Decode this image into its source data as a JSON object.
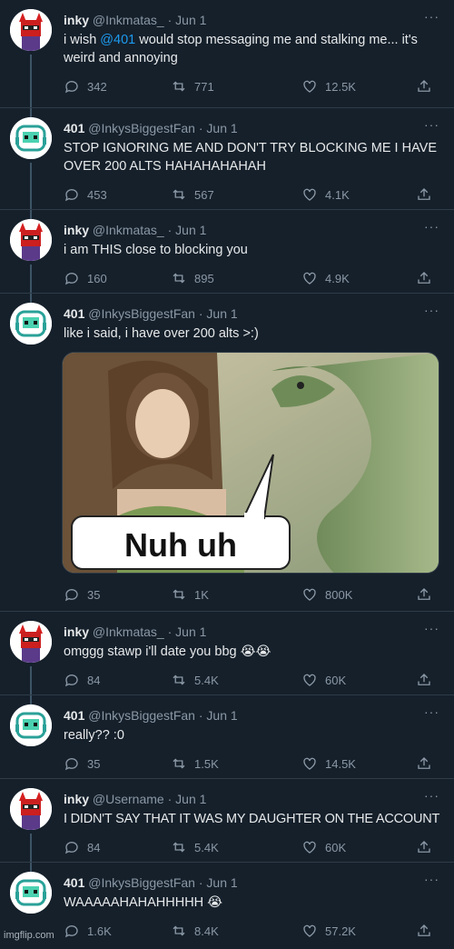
{
  "tweets": [
    {
      "name": "inky",
      "handle": "@Inkmatas_",
      "date": "Jun 1",
      "text_before": "i wish ",
      "mention": "@401",
      "text_after": " would stop messaging me and stalking me... it's weird and annoying",
      "replies": "342",
      "retweets": "771",
      "likes": "12.5K",
      "avatar": "red-devil-avatar"
    },
    {
      "name": "401",
      "handle": "@InkysBiggestFan",
      "date": "Jun 1",
      "text": "STOP IGNORING ME AND DON'T TRY BLOCKING ME I HAVE OVER 200 ALTS HAHAHAHAHAH",
      "replies": "453",
      "retweets": "567",
      "likes": "4.1K",
      "avatar": "green-robot-avatar"
    },
    {
      "name": "inky",
      "handle": "@Inkmatas_",
      "date": "Jun 1",
      "text": "i am THIS close to blocking you",
      "replies": "160",
      "retweets": "895",
      "likes": "4.9K",
      "avatar": "red-devil-avatar"
    },
    {
      "name": "401",
      "handle": "@InkysBiggestFan",
      "date": "Jun 1",
      "text": "like i said, i have over 200 alts >:)",
      "media_caption": "Nuh uh",
      "replies": "35",
      "retweets": "1K",
      "likes": "800K",
      "avatar": "green-robot-avatar"
    },
    {
      "name": "inky",
      "handle": "@Inkmatas_",
      "date": "Jun 1",
      "text": "omggg stawp i'll date you bbg 😭😭",
      "replies": "84",
      "retweets": "5.4K",
      "likes": "60K",
      "avatar": "red-devil-avatar"
    },
    {
      "name": "401",
      "handle": "@InkysBiggestFan",
      "date": "Jun 1",
      "text": "really?? :0",
      "replies": "35",
      "retweets": "1.5K",
      "likes": "14.5K",
      "avatar": "green-robot-avatar"
    },
    {
      "name": "inky",
      "handle": "@Username",
      "date": "Jun 1",
      "text": "I DIDN'T SAY THAT IT WAS MY DAUGHTER ON THE ACCOUNT",
      "replies": "84",
      "retweets": "5.4K",
      "likes": "60K",
      "avatar": "red-devil-avatar"
    },
    {
      "name": "401",
      "handle": "@InkysBiggestFan",
      "date": "Jun 1",
      "text": "WAAAAAHAHAHHHHH 😭",
      "replies": "1.6K",
      "retweets": "8.4K",
      "likes": "57.2K",
      "avatar": "green-robot-avatar"
    }
  ],
  "dot": "·",
  "more": "···",
  "watermark": "imgflip.com",
  "colors": {
    "background": "#15202b",
    "mention": "#1d9bf0",
    "muted": "#8b98a5"
  }
}
